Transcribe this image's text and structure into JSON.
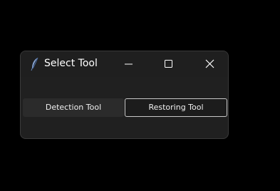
{
  "window": {
    "title": "Select Tool",
    "app_icon": "feather-icon",
    "controls": {
      "minimize_icon": "minimize-icon",
      "maximize_icon": "maximize-icon",
      "close_icon": "close-icon"
    }
  },
  "buttons": {
    "detection_label": "Detection Tool",
    "restoring_label": "Restoring Tool"
  },
  "colors": {
    "window_background": "#202020",
    "desktop_background": "#000000",
    "text": "#ffffff",
    "focus_border": "#c8c8c8"
  }
}
